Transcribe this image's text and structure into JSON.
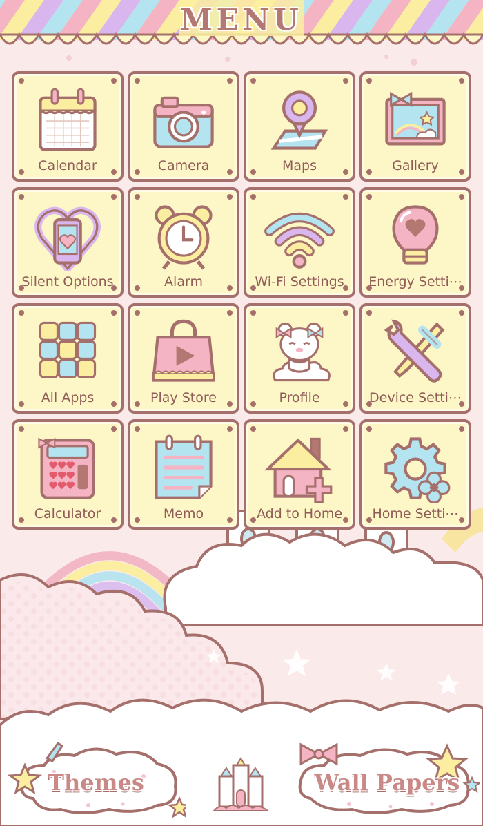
{
  "header": {
    "title": "MENU"
  },
  "apps": [
    {
      "label": "Calendar",
      "icon": "calendar-icon"
    },
    {
      "label": "Camera",
      "icon": "camera-icon"
    },
    {
      "label": "Maps",
      "icon": "map-pin-icon"
    },
    {
      "label": "Gallery",
      "icon": "gallery-icon"
    },
    {
      "label": "Silent Options",
      "icon": "phone-heart-icon"
    },
    {
      "label": "Alarm",
      "icon": "alarm-clock-icon"
    },
    {
      "label": "Wi-Fi Settings",
      "icon": "wifi-icon"
    },
    {
      "label": "Energy Setti⋯",
      "icon": "lightbulb-heart-icon"
    },
    {
      "label": "All Apps",
      "icon": "app-grid-icon"
    },
    {
      "label": "Play Store",
      "icon": "shopping-bag-play-icon"
    },
    {
      "label": "Profile",
      "icon": "bear-profile-icon"
    },
    {
      "label": "Device Setti⋯",
      "icon": "wrench-screwdriver-icon"
    },
    {
      "label": "Calculator",
      "icon": "calculator-icon"
    },
    {
      "label": "Memo",
      "icon": "memo-icon"
    },
    {
      "label": "Add to Home",
      "icon": "house-plus-icon"
    },
    {
      "label": "Home Setti⋯",
      "icon": "gear-plus-icon"
    }
  ],
  "footer": {
    "themes_label": "Themes",
    "wallpapers_label": "Wall Papers",
    "center_icon": "castle-icon"
  },
  "colors": {
    "border": "#a5706c",
    "tile_bg": "#fdf6c6",
    "pink": "#f4b4c4",
    "blue": "#b3e4f0",
    "yellow": "#fbeea0",
    "lavender": "#d9b6ee",
    "background": "#fbeaea"
  }
}
